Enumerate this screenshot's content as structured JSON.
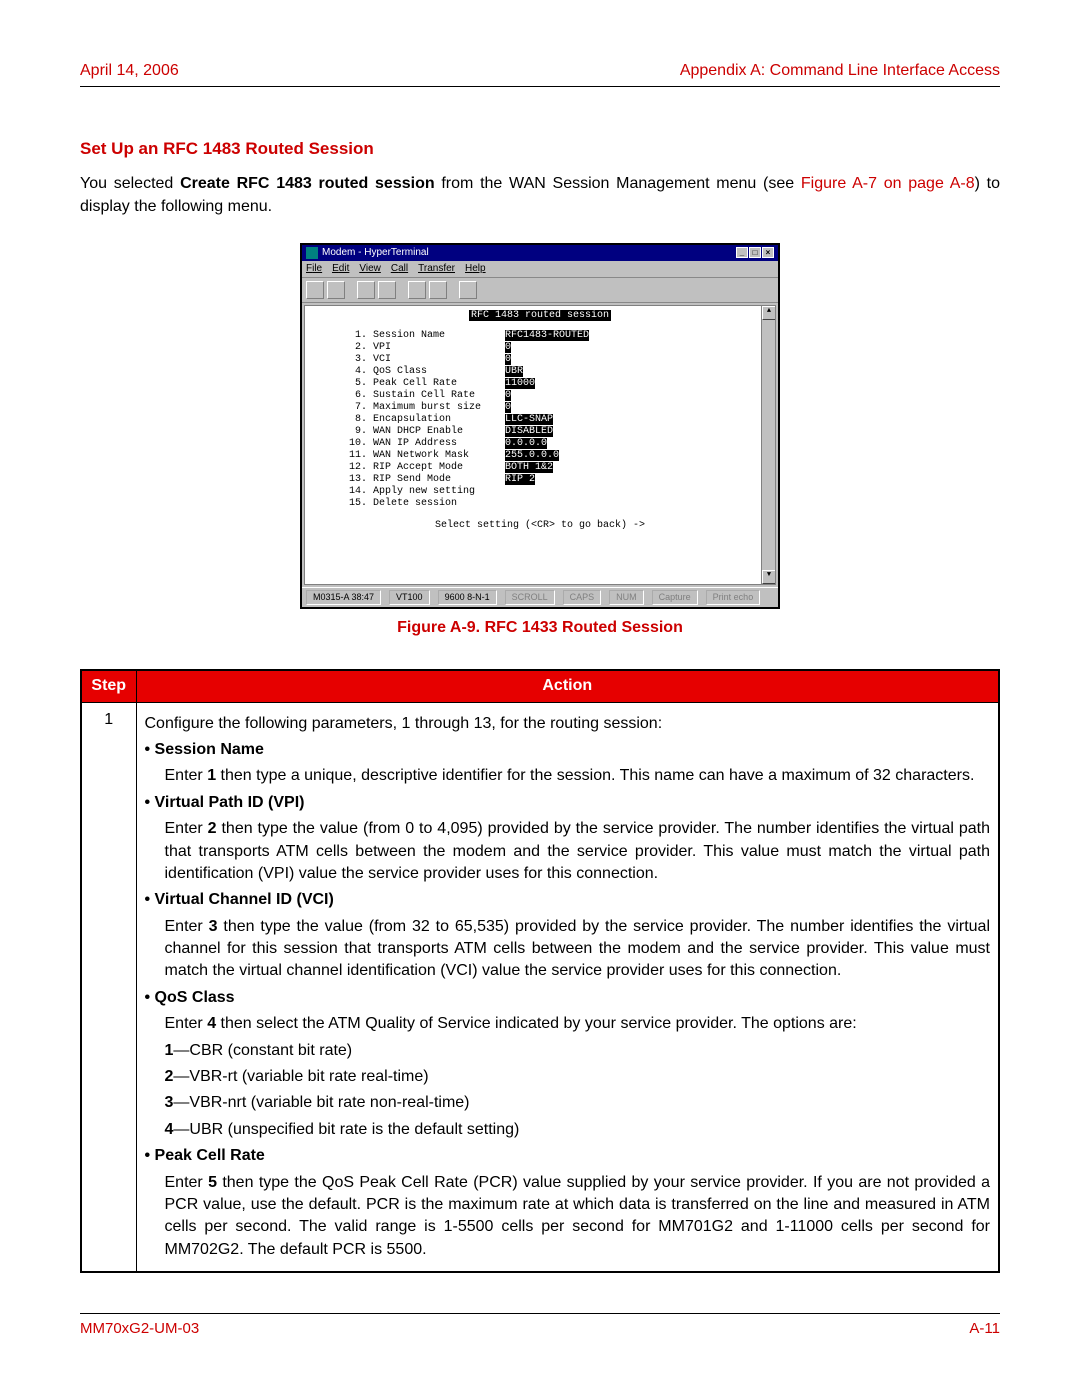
{
  "header": {
    "left": "April 14, 2006",
    "right": "Appendix A: Command Line Interface Access"
  },
  "section_heading": "Set Up an RFC 1483 Routed Session",
  "intro": {
    "pre": "You selected ",
    "bold": "Create RFC 1483 routed session",
    "mid": " from the WAN Session Management menu (see ",
    "link": "Figure A-7 on page A-8",
    "post": ") to display the following menu."
  },
  "terminal": {
    "title": "Modem - HyperTerminal",
    "menus": [
      "File",
      "Edit",
      "View",
      "Call",
      "Transfer",
      "Help"
    ],
    "body_title": "RFC 1483 routed session",
    "rows": [
      {
        "num": " 1.",
        "label": "Session Name",
        "val": "RFC1483-ROUTED",
        "hl": true
      },
      {
        "num": " 2.",
        "label": "VPI",
        "val": "0",
        "hl": true
      },
      {
        "num": " 3.",
        "label": "VCI",
        "val": "0",
        "hl": true
      },
      {
        "num": " 4.",
        "label": "QoS Class",
        "val": "UBR",
        "hl": true
      },
      {
        "num": " 5.",
        "label": "Peak Cell Rate",
        "val": "11000",
        "hl": true
      },
      {
        "num": " 6.",
        "label": "Sustain Cell Rate",
        "val": "0",
        "hl": true
      },
      {
        "num": " 7.",
        "label": "Maximum burst size",
        "val": "0",
        "hl": true
      },
      {
        "num": " 8.",
        "label": "Encapsulation",
        "val": "LLC-SNAP",
        "hl": true
      },
      {
        "num": " 9.",
        "label": "WAN DHCP Enable",
        "val": "DISABLED",
        "hl": true
      },
      {
        "num": "10.",
        "label": "WAN IP Address",
        "val": "0.0.0.0",
        "hl": true
      },
      {
        "num": "11.",
        "label": "WAN Network Mask",
        "val": "255.0.0.0",
        "hl": true
      },
      {
        "num": "12.",
        "label": "RIP Accept Mode",
        "val": "BOTH 1&2",
        "hl": true
      },
      {
        "num": "13.",
        "label": "RIP Send Mode",
        "val": "RIP 2",
        "hl": true
      },
      {
        "num": "14.",
        "label": "Apply new setting",
        "val": "",
        "hl": false
      },
      {
        "num": "15.",
        "label": "Delete session",
        "val": "",
        "hl": false
      }
    ],
    "prompt": "Select setting (<CR> to go back) ->",
    "status": {
      "left": "M0315-A 38:47",
      "term": "VT100",
      "conn": "9600 8-N-1",
      "dim": [
        "SCROLL",
        "CAPS",
        "NUM",
        "Capture",
        "Print echo"
      ]
    }
  },
  "figure_caption": "Figure A-9. RFC 1433 Routed Session",
  "table": {
    "headers": [
      "Step",
      "Action"
    ],
    "step": "1",
    "intro": "Configure the following parameters, 1 through 13, for the routing session:",
    "items": [
      {
        "head": "Session Name",
        "paras": [
          "Enter 1 then type a unique, descriptive identifier for the session. This name can have a maximum of 32 characters."
        ],
        "bold_indices": [
          "1"
        ]
      },
      {
        "head": "Virtual Path ID (VPI)",
        "paras": [
          "Enter 2 then type the value (from 0 to 4,095) provided by the service provider. The number identifies the virtual path that transports ATM cells between the modem and the service provider. This value must match the virtual path identification (VPI) value the service provider uses for this connection."
        ],
        "bold_indices": [
          "2"
        ]
      },
      {
        "head": "Virtual Channel ID (VCI)",
        "paras": [
          "Enter 3 then type the value (from 32 to 65,535) provided by the service provider. The number identifies the virtual channel for this session that transports ATM cells between the modem and the service provider. This value must match the virtual channel identification (VCI) value the service provider uses for this connection."
        ],
        "bold_indices": [
          "3"
        ]
      },
      {
        "head": "QoS Class",
        "paras": [
          "Enter 4 then select the ATM Quality of Service indicated by your service provider. The options are:"
        ],
        "bold_indices": [
          "4"
        ],
        "options": [
          {
            "key": "1",
            "text": "—CBR (constant bit rate)"
          },
          {
            "key": "2",
            "text": "—VBR-rt (variable bit rate real-time)"
          },
          {
            "key": "3",
            "text": "—VBR-nrt (variable bit rate non-real-time)"
          },
          {
            "key": "4",
            "text": "—UBR (unspecified bit rate is the default setting)"
          }
        ]
      },
      {
        "head": "Peak Cell Rate",
        "paras": [
          "Enter 5 then type the QoS Peak Cell Rate (PCR) value supplied by your service provider. If you are not provided a PCR value, use the default. PCR is the maximum rate at which data is transferred on the line and measured in ATM cells per second. The valid range is 1-5500 cells per second for MM701G2 and 1-11000 cells per second for MM702G2. The default PCR is 5500."
        ],
        "bold_indices": [
          "5"
        ]
      }
    ]
  },
  "footer": {
    "left": "MM70xG2-UM-03",
    "right": "A-11"
  }
}
